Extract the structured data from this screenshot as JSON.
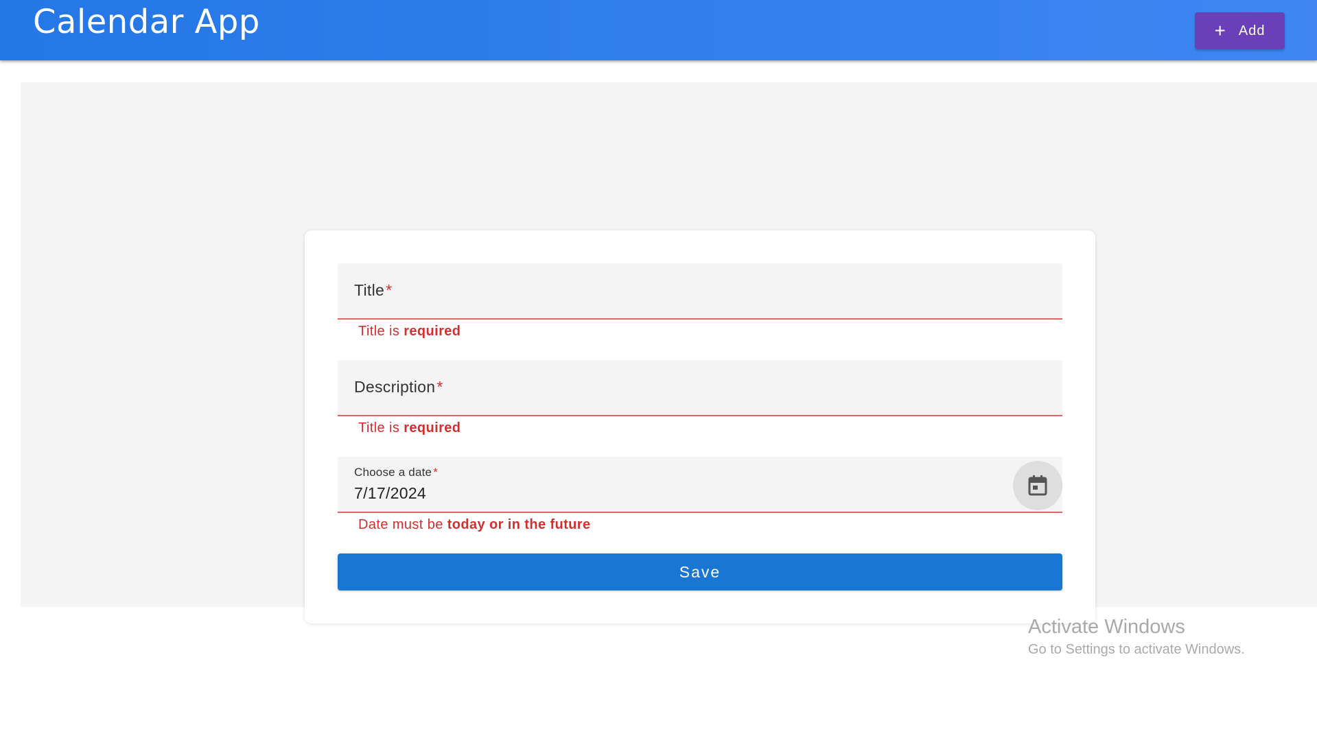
{
  "header": {
    "app_title": "Calendar App",
    "add_button_label": "Add"
  },
  "form": {
    "title_field": {
      "label": "Title",
      "required_mark": "*",
      "value": "",
      "error_prefix": "Title is ",
      "error_bold": "required"
    },
    "description_field": {
      "label": "Description",
      "required_mark": "*",
      "value": "",
      "error_prefix": "Title is ",
      "error_bold": "required"
    },
    "date_field": {
      "label": "Choose a date",
      "required_mark": "*",
      "value": "7/17/2024",
      "error_prefix": "Date must be ",
      "error_bold": "today or in the future"
    },
    "save_label": "Save"
  },
  "watermark": {
    "title": "Activate Windows",
    "subtitle": "Go to Settings to activate Windows."
  },
  "colors": {
    "app_bar": "#2477e6",
    "add_button": "#6a3fb8",
    "save_button": "#1976d2",
    "error": "#d32f2f"
  },
  "icons": {
    "add": "plus-icon",
    "date_picker": "calendar-icon"
  }
}
